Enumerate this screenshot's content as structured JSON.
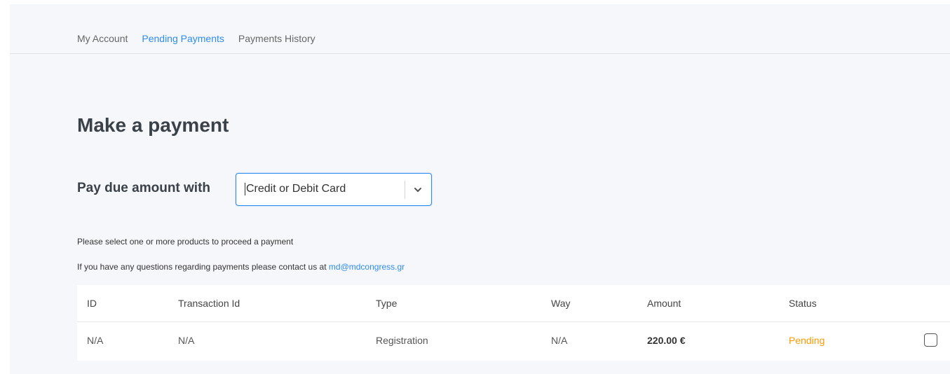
{
  "tabs": [
    {
      "label": "My Account",
      "active": false
    },
    {
      "label": "Pending Payments",
      "active": true
    },
    {
      "label": "Payments History",
      "active": false
    }
  ],
  "page": {
    "title": "Make a payment",
    "pay_label": "Pay due amount with",
    "payment_method": {
      "selected": "Credit or Debit Card",
      "icon": "chevron-down-icon"
    },
    "info_select": "Please select one or more products to proceed a payment",
    "info_contact_prefix": "If you have any questions regarding payments please contact us at",
    "info_contact_email": "md@mdcongress.gr"
  },
  "table": {
    "headers": {
      "id": "ID",
      "transaction_id": "Transaction Id",
      "type": "Type",
      "way": "Way",
      "amount": "Amount",
      "status": "Status"
    },
    "rows": [
      {
        "id": "N/A",
        "transaction_id": "N/A",
        "type": "Registration",
        "way": "N/A",
        "amount": "220.00 €",
        "status": "Pending",
        "checked": false
      }
    ]
  },
  "colors": {
    "accent": "#2d8cf0",
    "pending": "#ff9900",
    "background": "#f6f7fa"
  }
}
